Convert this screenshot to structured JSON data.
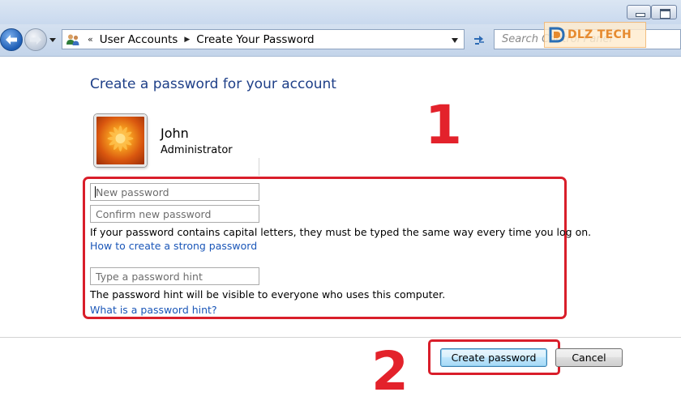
{
  "window": {
    "minimize_icon": "minimize-icon",
    "maximize_icon": "maximize-icon"
  },
  "navigation": {
    "breadcrumbs": [
      "User Accounts",
      "Create Your Password"
    ],
    "search_placeholder": "Search Control Panel",
    "watermark_text": "DLZ TECH"
  },
  "page": {
    "heading": "Create a password for your account"
  },
  "user": {
    "name": "John",
    "role": "Administrator"
  },
  "form": {
    "new_password_placeholder": "New password",
    "confirm_password_placeholder": "Confirm new password",
    "caps_note": "If your password contains capital letters, they must be typed the same way every time you log on.",
    "strong_password_link": "How to create a strong password",
    "hint_placeholder": "Type a password hint",
    "hint_note": "The password hint will be visible to everyone who uses this computer.",
    "hint_help_link": "What is a password hint?"
  },
  "buttons": {
    "create": "Create password",
    "cancel": "Cancel"
  },
  "annotations": {
    "step_1": "1",
    "step_2": "2",
    "highlight_color": "#d91e2a"
  },
  "colors": {
    "heading": "#1e3f88",
    "link": "#1a56b8"
  }
}
